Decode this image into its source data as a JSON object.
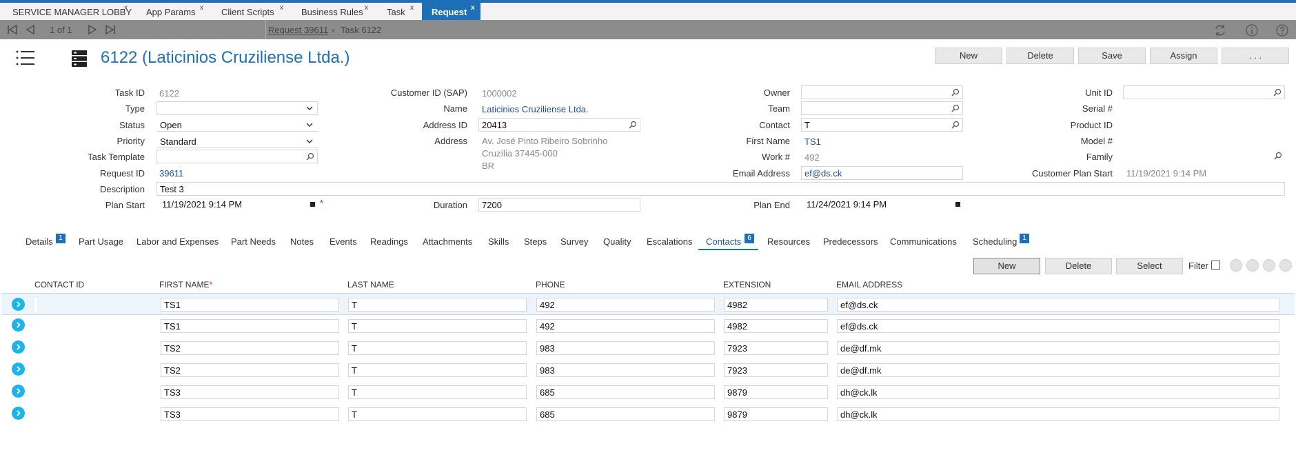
{
  "tabs": [
    {
      "label": "SERVICE MANAGER LOBBY",
      "close": "x"
    },
    {
      "label": "App Params",
      "close": "x"
    },
    {
      "label": "Client Scripts",
      "close": "x"
    },
    {
      "label": "Business Rules",
      "close": "x"
    },
    {
      "label": "Task",
      "close": "x"
    },
    {
      "label": "Request",
      "close": "x"
    }
  ],
  "nav": {
    "page": "1 of 1"
  },
  "breadcrumb": {
    "link": "Request 39611",
    "separator": "›",
    "current": "Task 6122"
  },
  "header": {
    "title": "6122 (Laticinios Cruziliense Ltda.)"
  },
  "actions": {
    "new": "New",
    "delete": "Delete",
    "save": "Save",
    "assign": "Assign",
    "more": ". . ."
  },
  "form": {
    "task_id": {
      "label": "Task ID",
      "value": "6122"
    },
    "type": {
      "label": "Type",
      "value": ""
    },
    "status": {
      "label": "Status",
      "value": "Open"
    },
    "priority": {
      "label": "Priority",
      "value": "Standard"
    },
    "task_template": {
      "label": "Task Template",
      "value": ""
    },
    "request_id": {
      "label": "Request ID",
      "value": "39611"
    },
    "description": {
      "label": "Description",
      "value": "Test 3"
    },
    "plan_start": {
      "label": "Plan Start",
      "value": "11/19/2021 9:14 PM",
      "required": "*"
    },
    "customer_id": {
      "label": "Customer ID (SAP)",
      "value": "1000002"
    },
    "name": {
      "label": "Name",
      "value": "Laticinios Cruziliense Ltda."
    },
    "address_id": {
      "label": "Address ID",
      "value": "20413"
    },
    "address": {
      "label": "Address",
      "line1": "Av. José Pinto Ribeiro Sobrinho",
      "line2": "Cruzília 37445-000",
      "line3": "BR"
    },
    "duration": {
      "label": "Duration",
      "value": "7200"
    },
    "owner": {
      "label": "Owner",
      "value": ""
    },
    "team": {
      "label": "Team",
      "value": ""
    },
    "contact": {
      "label": "Contact",
      "value": "T"
    },
    "first_name": {
      "label": "First Name",
      "value": "TS1"
    },
    "work": {
      "label": "Work #",
      "value": "492"
    },
    "email": {
      "label": "Email Address",
      "value": "ef@ds.ck"
    },
    "plan_end": {
      "label": "Plan End",
      "value": "11/24/2021 9:14 PM"
    },
    "unit_id": {
      "label": "Unit ID",
      "value": ""
    },
    "serial": {
      "label": "Serial #",
      "value": ""
    },
    "product_id": {
      "label": "Product ID",
      "value": ""
    },
    "model": {
      "label": "Model #",
      "value": ""
    },
    "family": {
      "label": "Family",
      "value": ""
    },
    "customer_plan_start": {
      "label": "Customer Plan Start",
      "value": "11/19/2021 9:14 PM"
    }
  },
  "subtabs": [
    {
      "label": "Details",
      "badge": "1"
    },
    {
      "label": "Part Usage",
      "badge": ""
    },
    {
      "label": "Labor and Expenses",
      "badge": ""
    },
    {
      "label": "Part Needs",
      "badge": ""
    },
    {
      "label": "Notes",
      "badge": ""
    },
    {
      "label": "Events",
      "badge": ""
    },
    {
      "label": "Readings",
      "badge": ""
    },
    {
      "label": "Attachments",
      "badge": ""
    },
    {
      "label": "Skills",
      "badge": ""
    },
    {
      "label": "Steps",
      "badge": ""
    },
    {
      "label": "Survey",
      "badge": ""
    },
    {
      "label": "Quality",
      "badge": ""
    },
    {
      "label": "Escalations",
      "badge": ""
    },
    {
      "label": "Contacts",
      "badge": "6"
    },
    {
      "label": "Resources",
      "badge": ""
    },
    {
      "label": "Predecessors",
      "badge": ""
    },
    {
      "label": "Communications",
      "badge": ""
    },
    {
      "label": "Scheduling",
      "badge": "1"
    }
  ],
  "grid_toolbar": {
    "new": "New",
    "delete": "Delete",
    "select": "Select",
    "filter": "Filter"
  },
  "grid": {
    "columns": [
      "CONTACT ID",
      "FIRST NAME",
      "LAST NAME",
      "PHONE",
      "EXTENSION",
      "EMAIL ADDRESS"
    ],
    "required_mark": "*",
    "rows": [
      {
        "contact_id": "",
        "first": "TS1",
        "last": "T",
        "phone": "492",
        "ext": "4982",
        "email": "ef@ds.ck"
      },
      {
        "contact_id": "",
        "first": "TS1",
        "last": "T",
        "phone": "492",
        "ext": "4982",
        "email": "ef@ds.ck"
      },
      {
        "contact_id": "",
        "first": "TS2",
        "last": "T",
        "phone": "983",
        "ext": "7923",
        "email": "de@df.mk"
      },
      {
        "contact_id": "",
        "first": "TS2",
        "last": "T",
        "phone": "983",
        "ext": "7923",
        "email": "de@df.mk"
      },
      {
        "contact_id": "",
        "first": "TS3",
        "last": "T",
        "phone": "685",
        "ext": "9879",
        "email": "dh@ck.lk"
      },
      {
        "contact_id": "",
        "first": "TS3",
        "last": "T",
        "phone": "685",
        "ext": "9879",
        "email": "dh@ck.lk"
      }
    ]
  },
  "colors": {
    "accent": "#1d6fb8",
    "row_button": "#1eb4e8",
    "navbar": "#8c8c8c"
  }
}
